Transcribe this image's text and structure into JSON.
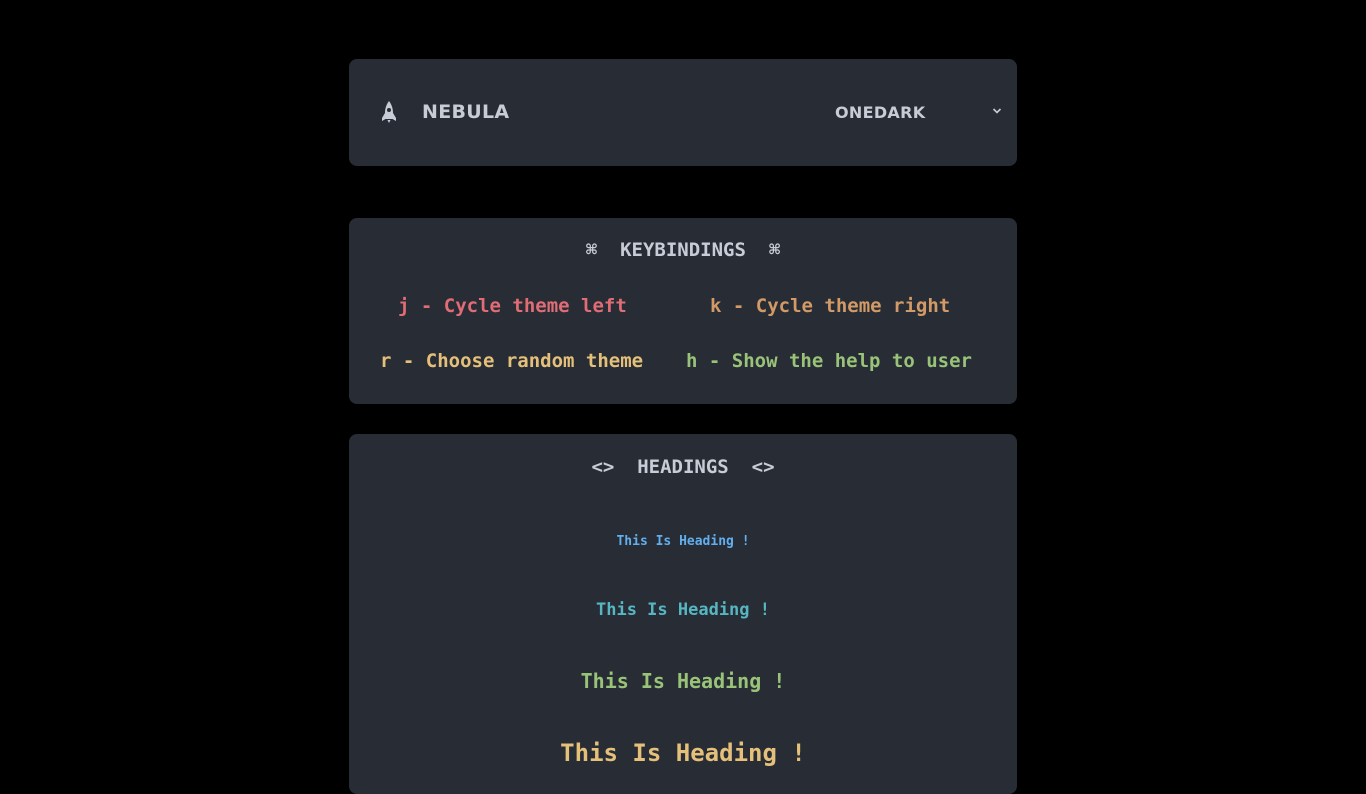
{
  "header": {
    "brand_icon": "rocket-icon",
    "brand_name": "NEBULA",
    "theme_selected": "ONEDARK",
    "theme_dropdown_icon": "chevron-down-icon"
  },
  "keybindings": {
    "title": "KEYBINDINGS",
    "title_icon": "command-icon",
    "icon_glyph": "⌘",
    "items": [
      {
        "text": "j - Cycle theme left",
        "color": "#e06c75"
      },
      {
        "text": "k - Cycle theme right",
        "color": "#d19a66"
      },
      {
        "text": "r - Choose random theme",
        "color": "#e5c07b"
      },
      {
        "text": "h - Show the help to user",
        "color": "#98c379"
      }
    ]
  },
  "headings": {
    "title": "HEADINGS",
    "title_icon": "code-icon",
    "icon_glyph": "<>",
    "items": [
      {
        "text": "This Is Heading !",
        "color": "#61afef"
      },
      {
        "text": "This Is Heading !",
        "color": "#56b6c2"
      },
      {
        "text": "This Is Heading !",
        "color": "#98c379"
      },
      {
        "text": "This Is Heading !",
        "color": "#e5c07b"
      }
    ]
  },
  "colors": {
    "page_background": "#000000",
    "card_background": "#282c34",
    "foreground": "#c7ccd6"
  }
}
